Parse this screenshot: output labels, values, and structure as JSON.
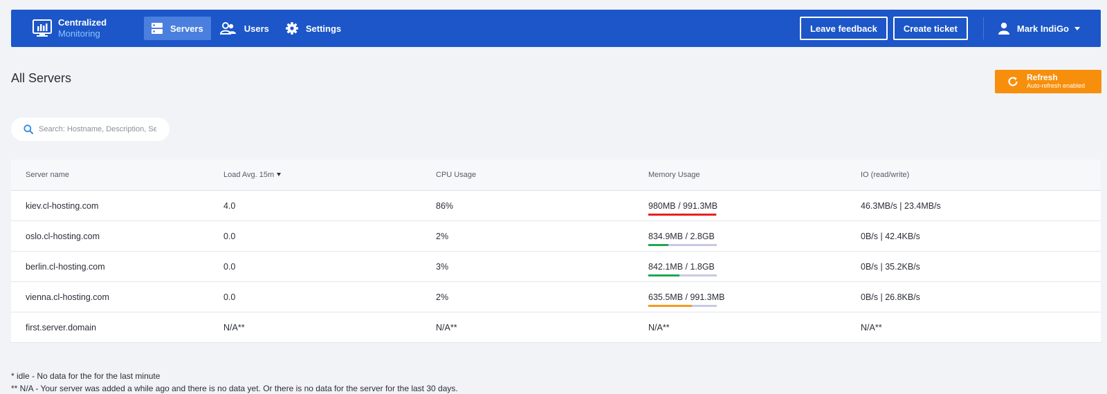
{
  "brand": {
    "line1": "Centralized",
    "line2": "Monitoring"
  },
  "nav": [
    {
      "label": "Servers",
      "icon": "servers-icon",
      "active": true
    },
    {
      "label": "Users",
      "icon": "users-icon",
      "active": false
    },
    {
      "label": "Settings",
      "icon": "gear-icon",
      "active": false
    }
  ],
  "header_actions": {
    "feedback": "Leave feedback",
    "ticket": "Create ticket"
  },
  "user": {
    "name": "Mark IndiGo"
  },
  "page": {
    "title": "All Servers"
  },
  "refresh": {
    "label": "Refresh",
    "sublabel": "Auto-refresh enabled"
  },
  "search": {
    "placeholder": "Search: Hostname, Description, Ser",
    "value": ""
  },
  "table": {
    "columns": [
      "Server name",
      "Load Avg. 15m",
      "CPU Usage",
      "Memory Usage",
      "IO (read/write)"
    ],
    "rows": [
      {
        "name": "kiev.cl-hosting.com",
        "load": "4.0",
        "cpu": "86%",
        "memory": "980MB / 991.3MB",
        "mem_fraction": 0.99,
        "mem_color": "#e8201f",
        "io": "46.3MB/s | 23.4MB/s"
      },
      {
        "name": "oslo.cl-hosting.com",
        "load": "0.0",
        "cpu": "2%",
        "memory": "834.9MB / 2.8GB",
        "mem_fraction": 0.29,
        "mem_color": "#1ea654",
        "io": "0B/s | 42.4KB/s"
      },
      {
        "name": "berlin.cl-hosting.com",
        "load": "0.0",
        "cpu": "3%",
        "memory": "842.1MB / 1.8GB",
        "mem_fraction": 0.45,
        "mem_color": "#1ea654",
        "io": "0B/s | 35.2KB/s"
      },
      {
        "name": "vienna.cl-hosting.com",
        "load": "0.0",
        "cpu": "2%",
        "memory": "635.5MB / 991.3MB",
        "mem_fraction": 0.64,
        "mem_color": "#f39a1e",
        "io": "0B/s | 26.8KB/s"
      },
      {
        "name": "first.server.domain",
        "load": "N/A**",
        "cpu": "N/A**",
        "memory": "N/A**",
        "mem_fraction": null,
        "mem_color": null,
        "io": "N/A**"
      }
    ]
  },
  "footnotes": [
    "* idle - No data for the for the last minute",
    "** N/A - Your server was added a while ago and there is no data yet. Or there is no data for the server for the last 30 days."
  ],
  "colors": {
    "nav_bg": "#1c56c8",
    "nav_active": "#4b7fde",
    "brand_accent": "#8dc4ff",
    "refresh_bg": "#f78f0c",
    "bar_track": "#c7c8e6"
  }
}
